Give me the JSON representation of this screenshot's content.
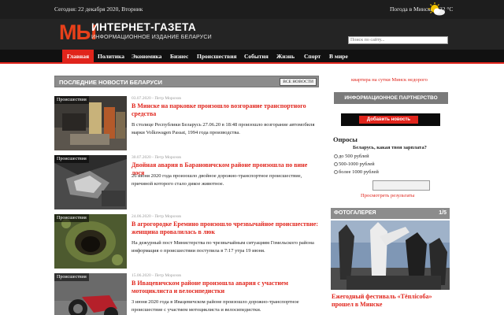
{
  "topbar": {
    "date": "Сегодня: 22 декабря 2020, Вторник",
    "weather": "Погода в Минске: +22 °C",
    "weather_icon": "partly-cloudy-icon"
  },
  "header": {
    "logo_short": "МЫ",
    "logo_title": "ИНТЕРНЕТ-ГАЗЕТА",
    "logo_subtitle": "ИНФОРМАЦИОННОЕ ИЗДАНИЕ БЕЛАРУСИ",
    "search_placeholder": "Поиск по сайту..."
  },
  "nav": {
    "items": [
      "Главная",
      "Политика",
      "Экономика",
      "Бизнес",
      "Происшествия",
      "События",
      "Жизнь",
      "Спорт",
      "В мире"
    ],
    "active": "Главная",
    "accent": "#e0241b"
  },
  "latest": {
    "title": "ПОСЛЕДНИЕ НОВОСТИ БЕЛАРУСИ",
    "all_label": "ВСЕ НОВОСТИ",
    "items": [
      {
        "category": "Происшествия",
        "meta": "03.07.2020 - Петр Морозов",
        "headline": "В Минске на парковке произошло возгорание транспортного средства",
        "excerpt": "В столице Республики Беларусь 27.06.20 в 18:48 произошло возгорание автомобиля марки Volkswagen Passat, 1994 года производства."
      },
      {
        "category": "Происшествия",
        "meta": "30.07.2020 - Петр Морозов",
        "headline": "Двойная авария в Барановичском районе произошла по вине лося",
        "excerpt": "26 июня 2020 года произошло двойное дорожно-транспортное происшествие, причиной которого стало дикое животное."
      },
      {
        "category": "Происшествия",
        "meta": "24.06.2020 - Петр Морозов",
        "headline": "В агрогородке Еремино произошло чрезвычайное происшествие: женщина провалилась в люк",
        "excerpt": "На дежурный пост Министерства по чрезвычайным ситуациям Гомельского района информация о происшествии поступила в 7:17 утра 19 июня."
      },
      {
        "category": "Происшествия",
        "meta": "15.06.2020 - Петр Морозов",
        "headline": "В Ивацевичском районе произошла авария с участием мотоциклиста и велосипедистки",
        "excerpt": "3 июня 2020 года в Ивацевичском районе произошло дорожно-транспортное происшествие с участием мотоциклиста и велосипедистки."
      }
    ]
  },
  "sidebar": {
    "link": "квартира на сутки Минск недорого",
    "partner_label": "ИНФОРМАЦИОННОЕ ПАРТНЕРСТВО",
    "add_news_label": "Добавить новость",
    "poll": {
      "title": "Опросы",
      "question": "Беларусь, какая твоя зарплата?",
      "options": [
        "до 500 рублей",
        "500-1000 рублей",
        "более 1000 рублей"
      ],
      "results_label": "Просмотреть результаты"
    },
    "gallery": {
      "title": "ФОТОГАЛЕРЕЯ",
      "counter": "1/5",
      "caption": "Ежегодный фестиваль «Тёплiсоба» прошел в Минске"
    }
  }
}
